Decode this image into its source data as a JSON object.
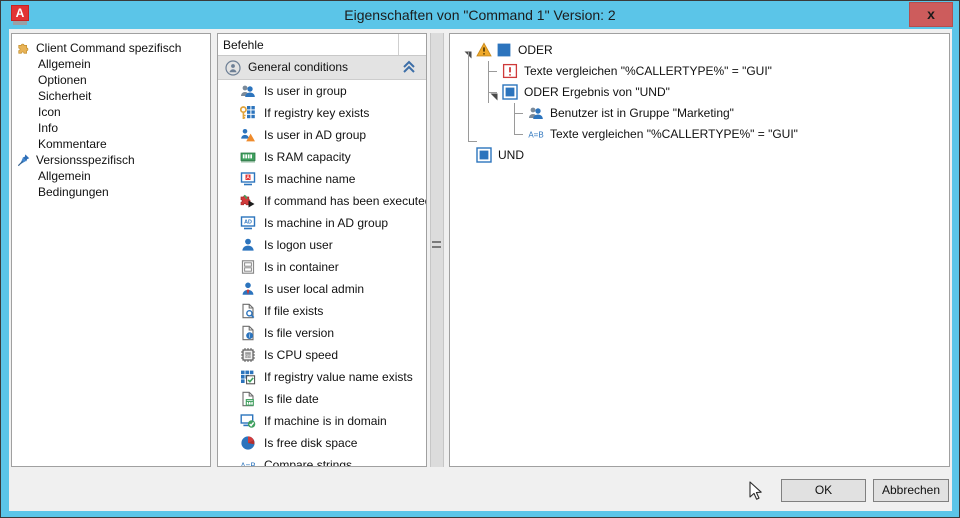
{
  "window": {
    "title": "Eigenschaften von \"Command 1\" Version: 2",
    "app_icon": "autocad-a-icon",
    "close_label": "x"
  },
  "left_tree": {
    "items": [
      {
        "label": "Client Command spezifisch",
        "level": 0,
        "icon": "puzzle-icon"
      },
      {
        "label": "Allgemein",
        "level": 1,
        "icon": ""
      },
      {
        "label": "Optionen",
        "level": 1,
        "icon": ""
      },
      {
        "label": "Sicherheit",
        "level": 1,
        "icon": ""
      },
      {
        "label": "Icon",
        "level": 1,
        "icon": ""
      },
      {
        "label": "Info",
        "level": 1,
        "icon": ""
      },
      {
        "label": "Kommentare",
        "level": 1,
        "icon": ""
      },
      {
        "label": "Versionsspezifisch",
        "level": 0,
        "icon": "pin-icon"
      },
      {
        "label": "Allgemein",
        "level": 1,
        "icon": ""
      },
      {
        "label": "Bedingungen",
        "level": 1,
        "icon": ""
      }
    ]
  },
  "commands_panel": {
    "search": {
      "value": "Befehle",
      "placeholder": "Befehle"
    },
    "group": {
      "label": "General conditions",
      "icon": "condition-group-icon",
      "collapse_icon": "chevron-up-icon"
    },
    "items": [
      {
        "label": "Is user in group",
        "icon": "users-group-icon"
      },
      {
        "label": "If registry key exists",
        "icon": "registry-key-icon"
      },
      {
        "label": "Is user in AD group",
        "icon": "user-ad-group-icon"
      },
      {
        "label": "Is RAM capacity",
        "icon": "ram-icon"
      },
      {
        "label": "Is machine name",
        "icon": "machine-name-icon"
      },
      {
        "label": "If command has been executed",
        "icon": "command-executed-icon"
      },
      {
        "label": "Is machine in AD group",
        "icon": "machine-ad-group-icon"
      },
      {
        "label": "Is logon user",
        "icon": "user-icon"
      },
      {
        "label": "Is in container",
        "icon": "container-icon"
      },
      {
        "label": "Is user local admin",
        "icon": "user-admin-icon"
      },
      {
        "label": "If file exists",
        "icon": "file-search-icon"
      },
      {
        "label": "Is file version",
        "icon": "file-info-icon"
      },
      {
        "label": "Is CPU speed",
        "icon": "cpu-icon"
      },
      {
        "label": "If registry value name exists",
        "icon": "registry-value-icon"
      },
      {
        "label": "Is file date",
        "icon": "file-date-icon"
      },
      {
        "label": "If machine is in domain",
        "icon": "machine-domain-icon"
      },
      {
        "label": "Is free disk space",
        "icon": "disk-space-icon"
      },
      {
        "label": "Compare strings",
        "icon": "compare-strings-icon"
      }
    ],
    "scrollbar": {
      "up_arrow": "▲",
      "down_arrow": "▼"
    }
  },
  "conditions_tree": {
    "items": [
      {
        "label": "ODER",
        "depth": 0,
        "icon": "or-node-icon",
        "warning": true,
        "expander": "expanded"
      },
      {
        "label": "Texte vergleichen \"%CALLERTYPE%\" = \"GUI\"",
        "depth": 1,
        "icon": "error-exclamation-icon",
        "warning": false,
        "expander": ""
      },
      {
        "label": "ODER Ergebnis von \"UND\"",
        "depth": 1,
        "icon": "or-result-icon",
        "warning": false,
        "expander": "expanded"
      },
      {
        "label": "Benutzer ist in Gruppe \"Marketing\"",
        "depth": 2,
        "icon": "users-group-icon",
        "warning": false,
        "expander": ""
      },
      {
        "label": "Texte vergleichen \"%CALLERTYPE%\" = \"GUI\"",
        "depth": 2,
        "icon": "ab-compare-icon",
        "warning": false,
        "expander": ""
      },
      {
        "label": "UND",
        "depth": 0,
        "icon": "and-node-icon",
        "warning": false,
        "expander": ""
      }
    ]
  },
  "buttons": {
    "ok": "OK",
    "cancel": "Abbrechen"
  },
  "colors": {
    "window_border": "#5bc5e8",
    "close_button": "#cd5c5c",
    "group_header": "#e3e3e3",
    "accent_blue": "#1f6fc4",
    "warning_amber": "#f0a92a"
  }
}
